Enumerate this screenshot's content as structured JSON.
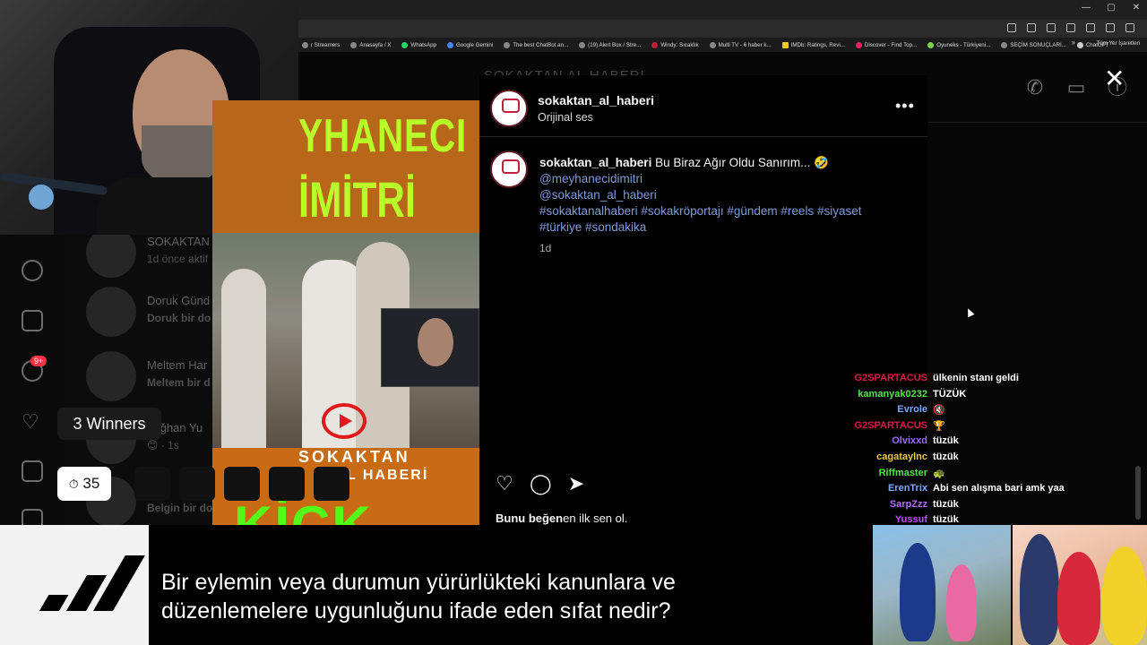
{
  "browser": {
    "window_controls": [
      "—",
      "▢",
      "✕"
    ],
    "bookmarks": [
      {
        "label": "r Streamers",
        "icon": "bookmark-icon"
      },
      {
        "label": "Anasayfa / X",
        "icon": "x-icon"
      },
      {
        "label": "WhatsApp",
        "icon": "whatsapp-icon"
      },
      {
        "label": "Google Gemini",
        "icon": "gemini-icon"
      },
      {
        "label": "The best ChatBot an...",
        "icon": "chatbot-icon"
      },
      {
        "label": "(19) Alert Box / Stre...",
        "icon": "alert-icon"
      },
      {
        "label": "Windy: Sıcaklık",
        "icon": "windy-icon"
      },
      {
        "label": "Multi TV - 6 haber k...",
        "icon": "tv-icon"
      },
      {
        "label": "IMDb: Ratings, Revi...",
        "icon": "imdb-icon"
      },
      {
        "label": "Discover - Find Top...",
        "icon": "discover-icon"
      },
      {
        "label": "Oyuneks - Türkiyeni...",
        "icon": "oyuneks-icon"
      },
      {
        "label": "SEÇİM SONUÇLARI...",
        "icon": "election-icon"
      },
      {
        "label": "ChatGPT",
        "icon": "chatgpt-icon"
      }
    ],
    "more_label": "»",
    "all_bookmarks": "Tüm Yer İşaretleri"
  },
  "dm": {
    "header_name": "SOKAKTAN AL HABERI",
    "items": [
      {
        "name": "SOKAKTAN",
        "sub": "1d önce aktif"
      },
      {
        "name": "Doruk Günd",
        "sub": "Doruk bir do"
      },
      {
        "name": "Meltem Har",
        "sub": "Meltem bir d"
      },
      {
        "name": "Tuğhan Yu",
        "sub": "😊 · 1s"
      },
      {
        "name": "",
        "sub": "Belgin bir do"
      }
    ],
    "notification_badge": "9+"
  },
  "video": {
    "title_line1": "YHANECI",
    "title_line2": "İMİTRİ",
    "brand_line1": "SOKAKTAN",
    "brand_line2": "L HABERİ",
    "kick": "KİCK"
  },
  "post": {
    "author": "sokaktan_al_haberi",
    "audio": "Orijinal ses",
    "more": "•••",
    "caption_user": "sokaktan_al_haberi",
    "caption_text": "Bu Biraz Ağır Oldu Sanırım... 🤣",
    "mentions": [
      "@meyhanecidimitri",
      "@sokaktan_al_haberi"
    ],
    "hashtags_line1": "#sokaktanalhaberi #sokakröportajı #gündem #reels #siyaset",
    "hashtags_line2": "#türkiye #sondakika",
    "time": "1d",
    "likes_bold": "Bunu beğen",
    "likes_rest": "en ilk sen ol.",
    "close": "✕"
  },
  "overlay": {
    "winners": "3 Winners",
    "timer_icon": "⏱",
    "timer": "35"
  },
  "chat": [
    {
      "user": "G2SPARTACUS",
      "color": "#e2174b",
      "msg": "ülkenin stanı geldi"
    },
    {
      "user": "kamanyak0232",
      "color": "#57e34f",
      "msg": "TÜZÜK"
    },
    {
      "user": "Evrole",
      "color": "#7fa8ff",
      "msg": "🔇"
    },
    {
      "user": "G2SPARTACUS",
      "color": "#e2174b",
      "msg": "🏆"
    },
    {
      "user": "Olvixxd",
      "color": "#9a6cff",
      "msg": "tüzük"
    },
    {
      "user": "cagataylnc",
      "color": "#e9c84a",
      "msg": "tüzük"
    },
    {
      "user": "Riffmaster",
      "color": "#57e34f",
      "msg": "🐢"
    },
    {
      "user": "ErenTrix",
      "color": "#7fa8ff",
      "msg": "Abi sen alışma bari amk yaa"
    },
    {
      "user": "SarpZzz",
      "color": "#b56cff",
      "msg": "tüzük"
    },
    {
      "user": "Yussuf",
      "color": "#c04aff",
      "msg": "tüzük"
    }
  ],
  "ad": {
    "question_line1": "Bir eylemin veya durumun yürürlükteki kanunlara ve",
    "question_line2": "düzenlemelere uygunluğunu ifade eden sıfat nedir?"
  }
}
